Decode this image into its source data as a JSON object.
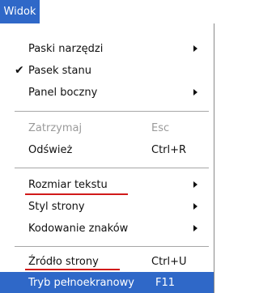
{
  "menubar": {
    "title": "Widok"
  },
  "menu": {
    "items": [
      {
        "label": "Paski narzędzi",
        "shortcut": "",
        "checked": false
      },
      {
        "label": "Pasek stanu",
        "shortcut": "",
        "checked": true
      },
      {
        "label": "Panel boczny",
        "shortcut": ""
      },
      {
        "label": "Zatrzymaj",
        "shortcut": "Esc",
        "disabled": true
      },
      {
        "label": "Odśwież",
        "shortcut": "Ctrl+R"
      },
      {
        "label": "Rozmiar tekstu",
        "shortcut": ""
      },
      {
        "label": "Styl strony",
        "shortcut": ""
      },
      {
        "label": "Kodowanie znaków",
        "shortcut": ""
      },
      {
        "label": "Źródło strony",
        "shortcut": "Ctrl+U"
      },
      {
        "label": "Tryb pełnoekranowy",
        "shortcut": "F11"
      }
    ],
    "check_glyph": "✔",
    "accent_color": "#2f68c8",
    "annotation_color": "#d11a1a"
  }
}
